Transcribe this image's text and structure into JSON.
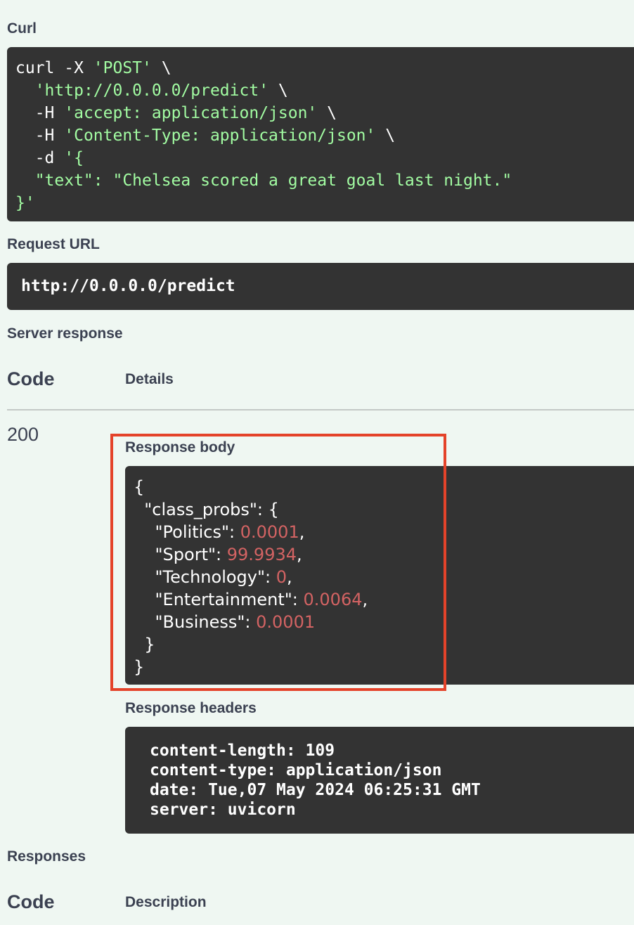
{
  "curl": {
    "label": "Curl",
    "lines": [
      [
        {
          "t": "curl -X ",
          "c": "plain"
        },
        {
          "t": "'POST'",
          "c": "str"
        },
        {
          "t": " \\",
          "c": "plain"
        }
      ],
      [
        {
          "t": "  ",
          "c": "plain"
        },
        {
          "t": "'http://0.0.0.0/predict'",
          "c": "str"
        },
        {
          "t": " \\",
          "c": "plain"
        }
      ],
      [
        {
          "t": "  -H ",
          "c": "plain"
        },
        {
          "t": "'accept: application/json'",
          "c": "str"
        },
        {
          "t": " \\",
          "c": "plain"
        }
      ],
      [
        {
          "t": "  -H ",
          "c": "plain"
        },
        {
          "t": "'Content-Type: application/json'",
          "c": "str"
        },
        {
          "t": " \\",
          "c": "plain"
        }
      ],
      [
        {
          "t": "  -d ",
          "c": "plain"
        },
        {
          "t": "'{",
          "c": "str"
        }
      ],
      [
        {
          "t": "  \"text\": \"Chelsea scored a great goal last night.\"",
          "c": "str"
        }
      ],
      [
        {
          "t": "}'",
          "c": "str"
        }
      ]
    ]
  },
  "request_url": {
    "label": "Request URL",
    "value": "http://0.0.0.0/predict"
  },
  "server_response": {
    "label": "Server response",
    "col_code": "Code",
    "col_details": "Details",
    "status_code": "200",
    "body_label": "Response body",
    "body_lines": [
      [
        {
          "t": "{",
          "c": "plain"
        }
      ],
      [
        {
          "t": "  \"class_probs\": {",
          "c": "plain"
        }
      ],
      [
        {
          "t": "    \"Politics\": ",
          "c": "plain"
        },
        {
          "t": "0.0001",
          "c": "num"
        },
        {
          "t": ",",
          "c": "plain"
        }
      ],
      [
        {
          "t": "    \"Sport\": ",
          "c": "plain"
        },
        {
          "t": "99.9934",
          "c": "num"
        },
        {
          "t": ",",
          "c": "plain"
        }
      ],
      [
        {
          "t": "    \"Technology\": ",
          "c": "plain"
        },
        {
          "t": "0",
          "c": "num"
        },
        {
          "t": ",",
          "c": "plain"
        }
      ],
      [
        {
          "t": "    \"Entertainment\": ",
          "c": "plain"
        },
        {
          "t": "0.0064",
          "c": "num"
        },
        {
          "t": ",",
          "c": "plain"
        }
      ],
      [
        {
          "t": "    \"Business\": ",
          "c": "plain"
        },
        {
          "t": "0.0001",
          "c": "num"
        }
      ],
      [
        {
          "t": "  }",
          "c": "plain"
        }
      ],
      [
        {
          "t": "}",
          "c": "plain"
        }
      ]
    ],
    "headers_label": "Response headers",
    "headers_lines": [
      " content-length: 109 ",
      " content-type: application/json ",
      " date: Tue,07 May 2024 06:25:31 GMT ",
      " server: uvicorn "
    ]
  },
  "responses": {
    "label": "Responses",
    "col_code": "Code",
    "col_description": "Description"
  },
  "colors": {
    "highlight_border": "#e4432a",
    "code_bg": "#333333",
    "string": "#a2fca2",
    "number": "#d36363"
  }
}
